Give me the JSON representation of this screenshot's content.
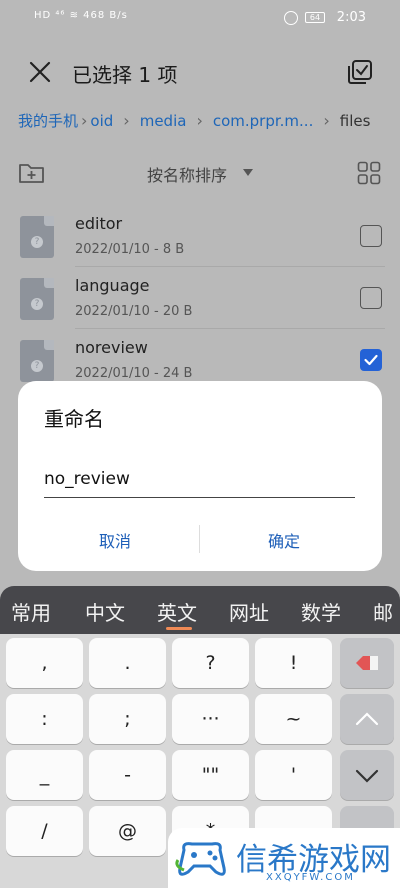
{
  "status_bar": {
    "left_icons": "HD ⁴⁶ ≋ 468 B/s",
    "battery": "64",
    "time": "2:03"
  },
  "header": {
    "title": "已选择 1 项",
    "close_icon": "close-icon",
    "select_all_icon": "select-all-icon"
  },
  "breadcrumb": [
    "我的手机",
    "oid",
    "media",
    "com.prpr.m...",
    "files"
  ],
  "sortbar": {
    "label": "按名称排序",
    "new_folder_icon": "new-folder-icon",
    "grid_icon": "grid-view-icon"
  },
  "files": [
    {
      "name": "editor",
      "meta": "2022/01/10 - 8 B",
      "checked": false
    },
    {
      "name": "language",
      "meta": "2022/01/10 - 20 B",
      "checked": false
    },
    {
      "name": "noreview",
      "meta": "2022/01/10 - 24 B",
      "checked": true
    }
  ],
  "dialog": {
    "title": "重命名",
    "input_value": "no_review",
    "cancel_label": "取消",
    "confirm_label": "确定"
  },
  "keyboard": {
    "tabs": [
      "常用",
      "中文",
      "英文",
      "网址",
      "数学",
      "邮"
    ],
    "active_tab": "英文",
    "rows": [
      [
        ",",
        ".",
        "?",
        "!"
      ],
      [
        ":",
        ";",
        "···",
        "~"
      ],
      [
        "_",
        "-",
        "\"\"",
        "'"
      ],
      [
        "/",
        "@",
        "*",
        ""
      ]
    ],
    "accent_color": "#f08a55"
  },
  "watermark": {
    "text": "信希游戏网",
    "sub": "XXQYFW.COM"
  }
}
